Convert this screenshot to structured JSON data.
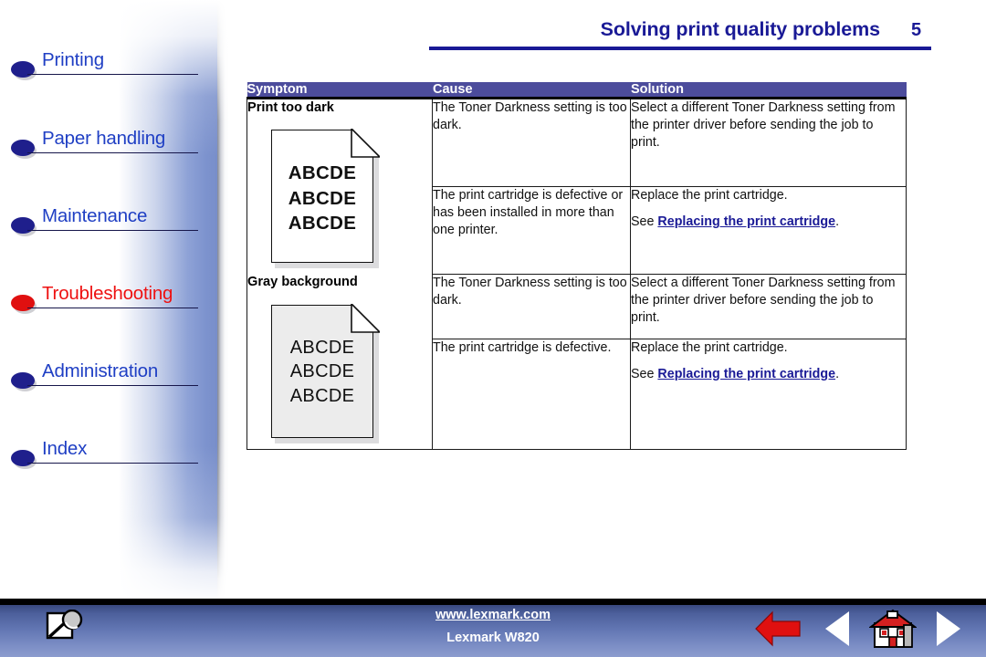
{
  "header": {
    "title": "Solving print quality problems",
    "page_number": "5",
    "accent_color": "#1a1a96"
  },
  "sidebar": {
    "items": [
      {
        "label": "Printing",
        "bullet_color": "#1f1f8c",
        "text_color": "#1f3fc4",
        "active": false
      },
      {
        "label": "Paper handling",
        "bullet_color": "#1f1f8c",
        "text_color": "#1f3fc4",
        "active": false
      },
      {
        "label": "Maintenance",
        "bullet_color": "#1f1f8c",
        "text_color": "#1f3fc4",
        "active": false
      },
      {
        "label": "Troubleshooting",
        "bullet_color": "#e01010",
        "text_color": "#ee1111",
        "active": true
      },
      {
        "label": "Administration",
        "bullet_color": "#1f1f8c",
        "text_color": "#1f3fc4",
        "active": false
      },
      {
        "label": "Index",
        "bullet_color": "#1f1f8c",
        "text_color": "#1f3fc4",
        "active": false
      }
    ]
  },
  "table": {
    "header_bg": "#4c4c9c",
    "columns": [
      "Symptom",
      "Cause",
      "Solution"
    ],
    "groups": [
      {
        "symptom": "Print too dark",
        "illustration": {
          "name": "print-too-dark-sample-page",
          "paper": "white",
          "text_weight": "bold",
          "lines": [
            "ABCDE",
            "ABCDE",
            "ABCDE"
          ]
        },
        "rows": [
          {
            "cause": "The Toner Darkness setting is too dark.",
            "solution_lines": [
              {
                "text": "Select a different Toner Darkness setting from the printer driver before sending the job to print."
              }
            ]
          },
          {
            "cause": "The print cartridge is defective or has been installed in more than one printer.",
            "solution_lines": [
              {
                "text": "Replace the print cartridge."
              },
              {
                "prefix": "See ",
                "link": "Replacing the print cartridge",
                "suffix": "."
              }
            ]
          }
        ]
      },
      {
        "symptom": "Gray background",
        "illustration": {
          "name": "gray-background-sample-page",
          "paper": "gray",
          "text_weight": "regular",
          "lines": [
            "ABCDE",
            "ABCDE",
            "ABCDE"
          ]
        },
        "rows": [
          {
            "cause": "The Toner Darkness setting is too dark.",
            "solution_lines": [
              {
                "text": "Select a different Toner Darkness setting from the printer driver before sending the job to print."
              }
            ]
          },
          {
            "cause": "The print cartridge is defective.",
            "solution_lines": [
              {
                "text": "Replace the print cartridge."
              },
              {
                "prefix": "See ",
                "link": "Replacing the print cartridge",
                "suffix": "."
              }
            ]
          }
        ]
      }
    ]
  },
  "footer": {
    "url": "www.lexmark.com",
    "model": "Lexmark W820",
    "icons": [
      {
        "name": "search-magnifier-icon",
        "position": "left"
      },
      {
        "name": "back-arrow-icon",
        "color": "#e01010"
      },
      {
        "name": "previous-page-icon",
        "color": "#ffffff"
      },
      {
        "name": "home-icon",
        "color": "#d42020"
      },
      {
        "name": "next-page-icon",
        "color": "#ffffff"
      }
    ]
  }
}
